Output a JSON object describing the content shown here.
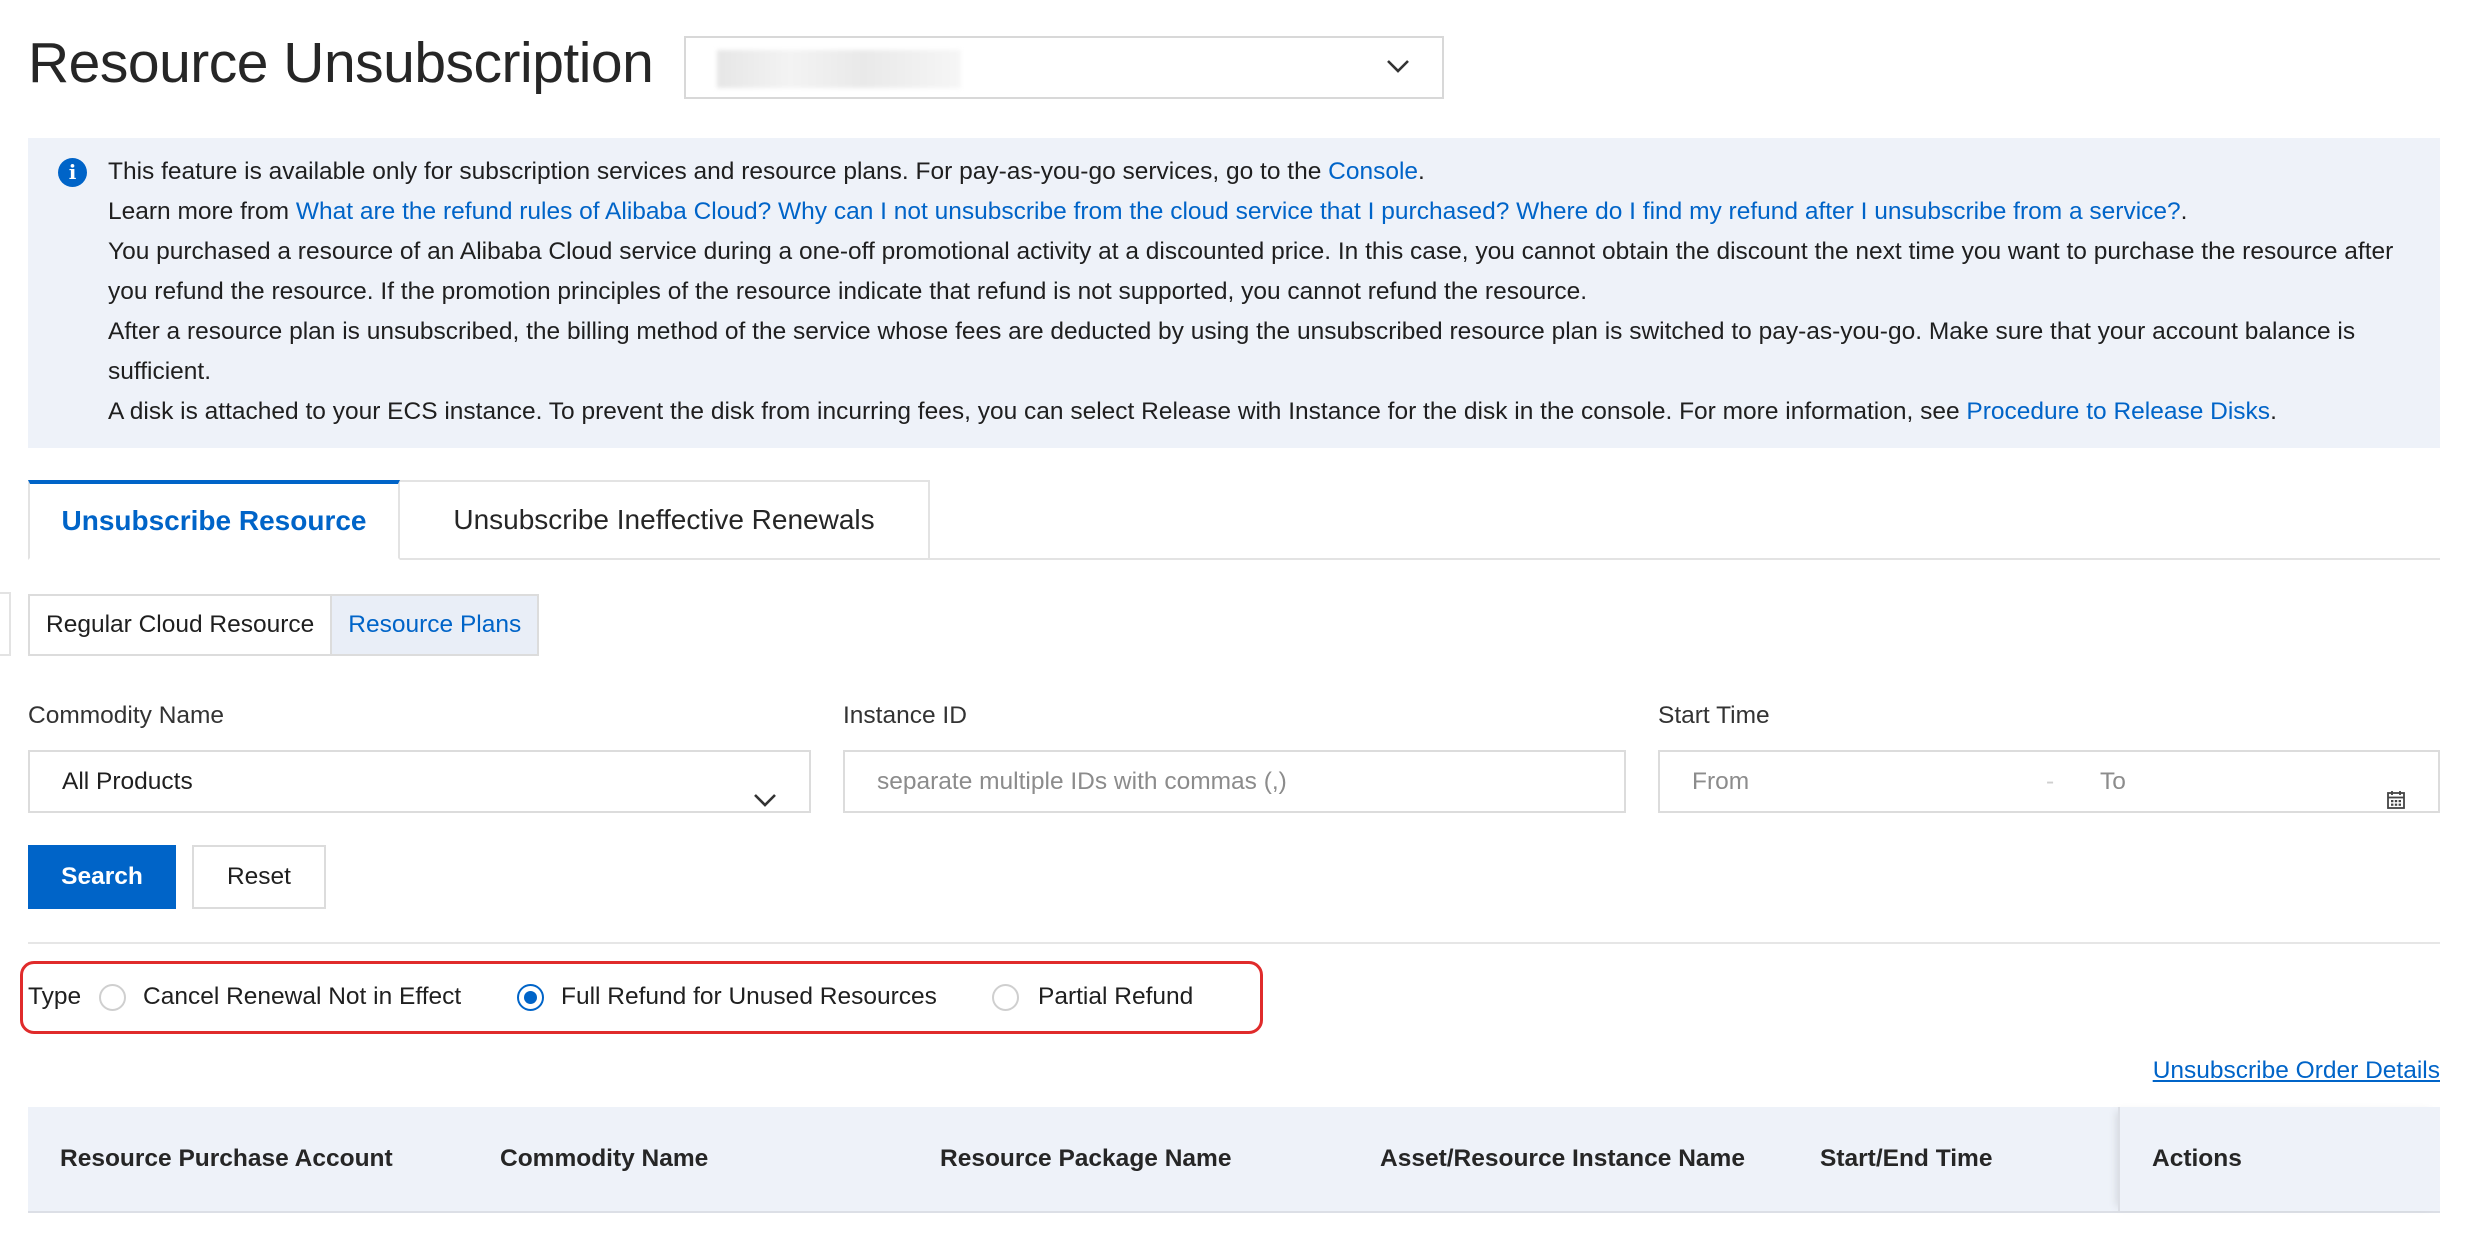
{
  "page": {
    "title": "Resource Unsubscription"
  },
  "account_selector": {
    "value": ""
  },
  "notice": {
    "line1_text": "This feature is available only for subscription services and resource plans. For pay-as-you-go services, go to the ",
    "line1_link": "Console",
    "line1_end": ".",
    "line2_text": "Learn more from ",
    "line2_link": "What are the refund rules of Alibaba Cloud? Why can I not unsubscribe from the cloud service that I purchased? Where do I find my refund after I unsubscribe from a service?",
    "line2_end": ".",
    "line3": "You purchased a resource of an Alibaba Cloud service during a one-off promotional activity at a discounted price. In this case, you cannot obtain the discount the next time you want to purchase the resource after you refund the resource. If the promotion principles of the resource indicate that refund is not supported, you cannot refund the resource.",
    "line4": "After a resource plan is unsubscribed, the billing method of the service whose fees are deducted by using the unsubscribed resource plan is switched to pay-as-you-go. Make sure that your account balance is sufficient.",
    "line5_text": "A disk is attached to your ECS instance. To prevent the disk from incurring fees, you can select Release with Instance for the disk in the console. For more information, see ",
    "line5_link": "Procedure to Release Disks",
    "line5_end": "."
  },
  "tabs": [
    {
      "label": "Unsubscribe Resource",
      "active": true
    },
    {
      "label": "Unsubscribe Ineffective Renewals",
      "active": false
    }
  ],
  "segments": [
    {
      "label": "Regular Cloud Resource",
      "active": false
    },
    {
      "label": "Resource Plans",
      "active": true
    }
  ],
  "filters": {
    "commodity_label": "Commodity Name",
    "commodity_value": "All Products",
    "instance_label": "Instance ID",
    "instance_placeholder": "separate multiple IDs with commas (,)",
    "start_label": "Start Time",
    "start_from_placeholder": "From",
    "range_separator": "-",
    "start_to_placeholder": "To"
  },
  "buttons": {
    "search": "Search",
    "reset": "Reset"
  },
  "type_filter": {
    "label": "Type",
    "options": [
      {
        "label": "Cancel Renewal Not in Effect",
        "checked": false
      },
      {
        "label": "Full Refund for Unused Resources",
        "checked": true
      },
      {
        "label": "Partial Refund",
        "checked": false
      }
    ]
  },
  "order_details_link": "Unsubscribe Order Details",
  "table": {
    "columns": [
      "Resource Purchase Account",
      "Commodity Name",
      "Resource Package Name",
      "Asset/Resource Instance Name",
      "Start/End Time",
      "Actions"
    ]
  },
  "colors": {
    "accent": "#0064c8",
    "highlight_border": "#e02b2b",
    "notice_bg": "#eef2f9"
  },
  "icons": [
    "info-icon",
    "chevron-down-icon",
    "calendar-icon"
  ]
}
